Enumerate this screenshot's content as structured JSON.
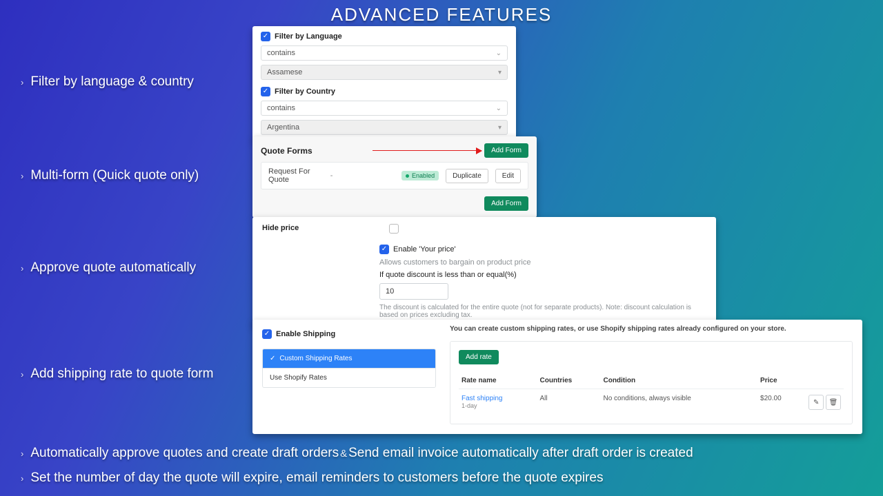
{
  "title": "ADVANCED FEATURES",
  "bullets": {
    "b1": "Filter by language & country",
    "b2": "Multi-form (Quick quote only)",
    "b3": "Approve quote automatically",
    "b4": "Add shipping rate to quote form",
    "b5a": "Automatically approve quotes and create draft orders",
    "b5b": "Send email invoice automatically after draft order is created",
    "b6": "Set the number of day the quote will expire, email reminders to customers before the quote expires"
  },
  "filter": {
    "lang_label": "Filter by Language",
    "lang_op": "contains",
    "lang_val": "Assamese",
    "country_label": "Filter by Country",
    "country_op": "contains",
    "country_val": "Argentina"
  },
  "forms": {
    "heading": "Quote Forms",
    "add_btn": "Add Form",
    "row": {
      "name": "Request For Quote",
      "status": "Enabled",
      "dup": "Duplicate",
      "edit": "Edit"
    }
  },
  "hide": {
    "label": "Hide price",
    "enable_label": "Enable 'Your price'",
    "desc1": "Allows customers to bargain on product price",
    "thresh_label": "If quote discount is less than or equal(%)",
    "thresh_val": "10",
    "desc2": "The discount is calculated for the entire quote (not for separate products). Note: discount calculation is based on prices excluding tax."
  },
  "ship": {
    "enable_label": "Enable Shipping",
    "tab_custom": "Custom Shipping Rates",
    "tab_shopify": "Use Shopify Rates",
    "desc": "You can create custom shipping rates, or use Shopify shipping rates already configured on your store.",
    "add_rate": "Add rate",
    "cols": {
      "name": "Rate name",
      "countries": "Countries",
      "cond": "Condition",
      "price": "Price"
    },
    "row": {
      "name": "Fast shipping",
      "sub": "1-day",
      "countries": "All",
      "cond": "No conditions, always visible",
      "price": "$20.00"
    }
  }
}
